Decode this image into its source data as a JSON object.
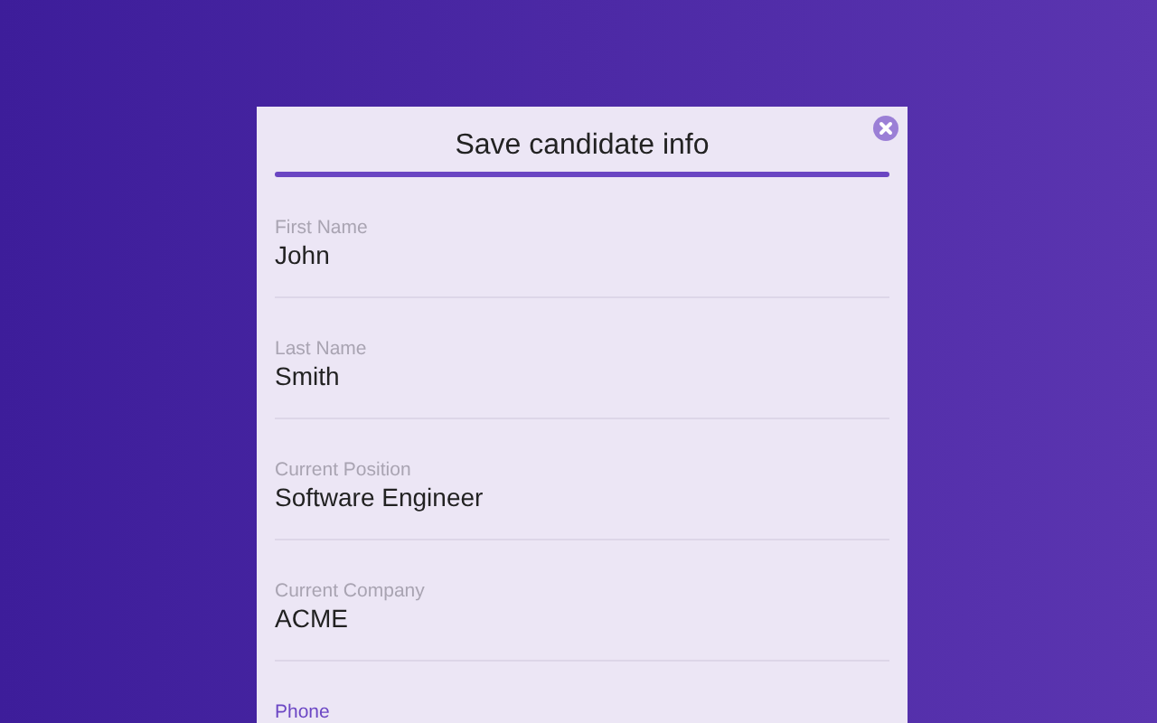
{
  "dialog": {
    "title": "Save candidate info",
    "fields": [
      {
        "label": "First Name",
        "value": "John",
        "focused": false
      },
      {
        "label": "Last Name",
        "value": "Smith",
        "focused": false
      },
      {
        "label": "Current Position",
        "value": "Software Engineer",
        "focused": false
      },
      {
        "label": "Current Company",
        "value": "ACME",
        "focused": false
      },
      {
        "label": "Phone",
        "focused": true
      }
    ]
  }
}
